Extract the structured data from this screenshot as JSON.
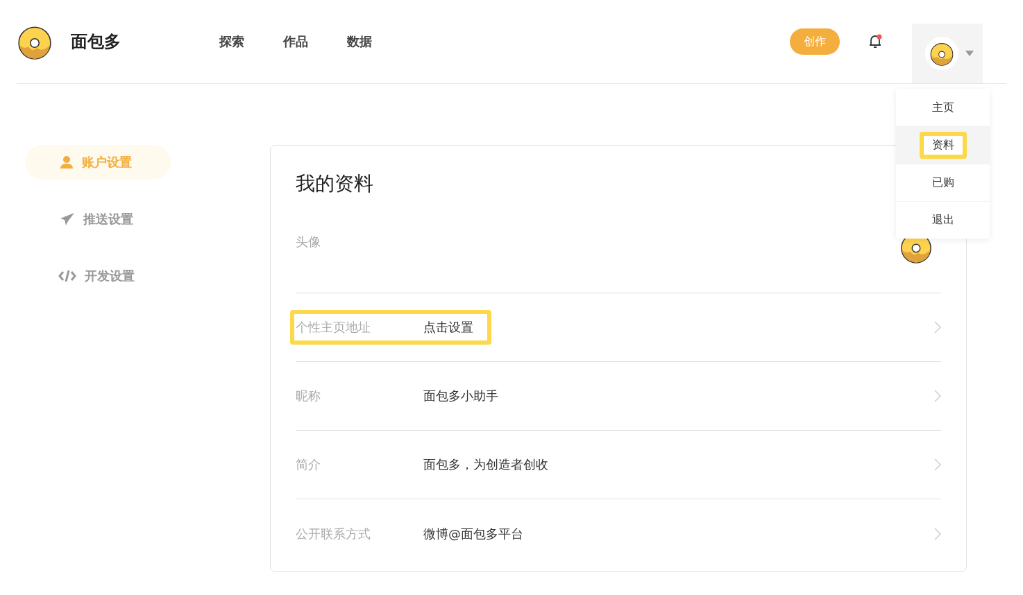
{
  "brand": {
    "name": "面包多"
  },
  "nav": [
    {
      "label": "探索"
    },
    {
      "label": "作品"
    },
    {
      "label": "数据"
    }
  ],
  "header": {
    "create_button": "创作",
    "notification_dot": true
  },
  "user_menu": {
    "open": true,
    "items": [
      {
        "label": "主页",
        "selected": false,
        "highlighted": false
      },
      {
        "label": "资料",
        "selected": true,
        "highlighted": true
      },
      {
        "label": "已购",
        "selected": false,
        "highlighted": false
      },
      {
        "label": "退出",
        "selected": false,
        "highlighted": false
      }
    ]
  },
  "sidebar": {
    "items": [
      {
        "label": "账户设置",
        "kind": "user",
        "selected": true
      },
      {
        "label": "推送设置",
        "kind": "send",
        "selected": false
      },
      {
        "label": "开发设置",
        "kind": "code",
        "selected": false
      }
    ]
  },
  "profile": {
    "title": "我的资料",
    "rows": [
      {
        "kind": "avatar",
        "label": "头像",
        "highlighted": false
      },
      {
        "kind": "text",
        "label": "个性主页地址",
        "value": "点击设置",
        "highlighted": true
      },
      {
        "kind": "text",
        "label": "昵称",
        "value": "面包多小助手",
        "highlighted": false
      },
      {
        "kind": "text",
        "label": "简介",
        "value": "面包多，为创造者创收",
        "highlighted": false
      },
      {
        "kind": "text",
        "label": "公开联系方式",
        "value": "微博@面包多平台",
        "highlighted": false
      }
    ]
  }
}
